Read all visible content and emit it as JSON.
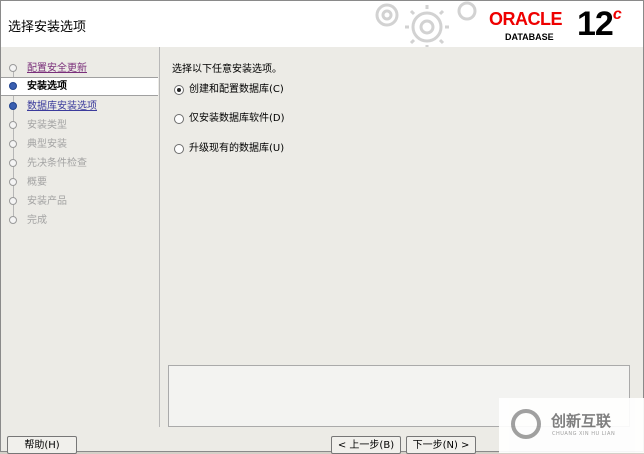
{
  "window": {
    "title": "选择安装选项"
  },
  "brand": {
    "oracle": "ORACLE",
    "database": "DATABASE",
    "version": "12",
    "version_sup": "c"
  },
  "steps": [
    {
      "label": "配置安全更新",
      "state": "visited"
    },
    {
      "label": "安装选项",
      "state": "current"
    },
    {
      "label": "数据库安装选项",
      "state": "link"
    },
    {
      "label": "安装类型",
      "state": "disabled"
    },
    {
      "label": "典型安装",
      "state": "disabled"
    },
    {
      "label": "先决条件检查",
      "state": "disabled"
    },
    {
      "label": "概要",
      "state": "disabled"
    },
    {
      "label": "安装产品",
      "state": "disabled"
    },
    {
      "label": "完成",
      "state": "disabled"
    }
  ],
  "main": {
    "prompt": "选择以下任意安装选项。",
    "options": [
      {
        "label": "创建和配置数据库(C)",
        "selected": true
      },
      {
        "label": "仅安装数据库软件(D)",
        "selected": false
      },
      {
        "label": "升级现有的数据库(U)",
        "selected": false
      }
    ]
  },
  "footer": {
    "help": "帮助(H)",
    "back": "< 上一步(B)",
    "next": "下一步(N) >"
  },
  "watermark": {
    "text": "创新互联",
    "sub": "CHUANG XIN HU LIAN"
  },
  "colors": {
    "oracle_red": "#e00000",
    "link": "#3b3b9c"
  }
}
